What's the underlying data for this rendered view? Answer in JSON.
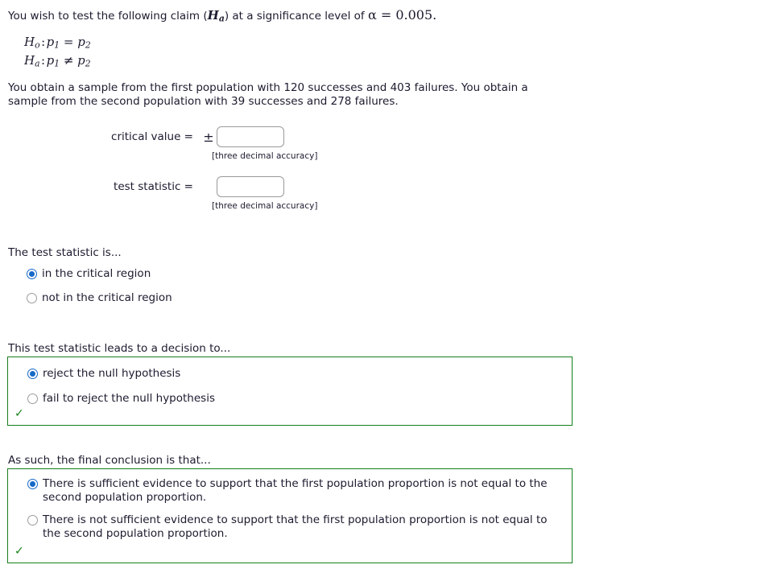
{
  "intro": {
    "prefix": "You wish to test the following claim (",
    "claim_symbol": "Ha",
    "middle": ") at a significance level of ",
    "alpha_expression": "α = 0.005."
  },
  "hypotheses": {
    "null": "Ho : p1 = p2",
    "alternative": "Ha : p1 ≠ p2",
    "null_parts": {
      "name": "H",
      "sub": "o",
      "left": "p",
      "left_sub": "1",
      "relation": "=",
      "right": "p",
      "right_sub": "2"
    },
    "alt_parts": {
      "name": "H",
      "sub": "a",
      "left": "p",
      "left_sub": "1",
      "relation": "≠",
      "right": "p",
      "right_sub": "2"
    }
  },
  "sample": {
    "text": "You obtain a sample from the first population with 120 successes and 403 failures. You obtain a sample from the second population with 39 successes and 278 failures.",
    "first_successes": "120",
    "first_failures": "403",
    "second_successes": "39",
    "second_failures": "278"
  },
  "fields": {
    "critical_value": {
      "label": "critical value =",
      "plus_minus": "±",
      "value": "",
      "placeholder": "",
      "hint": "[three decimal accuracy]"
    },
    "test_statistic": {
      "label": "test statistic =",
      "value": "",
      "placeholder": "",
      "hint": "[three decimal accuracy]"
    }
  },
  "region_question": {
    "heading": "The test statistic is...",
    "options": [
      {
        "label": "in the critical region",
        "selected": true
      },
      {
        "label": "not in the critical region",
        "selected": false
      }
    ]
  },
  "decision_question": {
    "heading": "This test statistic leads to a decision to...",
    "options": [
      {
        "label": "reject the null hypothesis",
        "selected": true
      },
      {
        "label": "fail to reject the null hypothesis",
        "selected": false
      }
    ],
    "status_icon": "check-mark",
    "status_symbol": "✓"
  },
  "conclusion_question": {
    "heading": "As such, the final conclusion is that...",
    "options": [
      {
        "label": "There is sufficient evidence to support that the first population proportion is not equal to the second population proportion.",
        "selected": true
      },
      {
        "label": "There is not sufficient evidence to support that the first population proportion is not equal to the second population proportion.",
        "selected": false
      }
    ],
    "status_icon": "check-mark",
    "status_symbol": "✓"
  },
  "colors": {
    "text": "#1b1b2f",
    "radio_selected": "#1569c7",
    "graded_border": "#16801a",
    "check": "#16801a",
    "input_border": "#9a9a9a"
  }
}
